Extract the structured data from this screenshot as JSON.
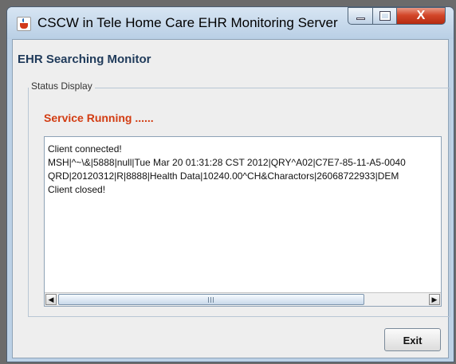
{
  "window": {
    "title": "CSCW in Tele Home Care EHR Monitoring Server",
    "app_icon": "java-coffee-icon",
    "controls": {
      "minimize_icon": "minimize-icon",
      "maximize_icon": "maximize-icon",
      "close_glyph": "X"
    }
  },
  "main": {
    "heading": "EHR Searching Monitor",
    "status_group": {
      "label": "Status Display",
      "status_text": "Service Running ......",
      "status_color": "#d23c12",
      "log_lines": [
        "Client connected!",
        "MSH|^~\\&|5888|null|Tue Mar 20 01:31:28 CST 2012|QRY^A02|C7E7-85-11-A5-0040",
        "QRD|20120312|R|8888|Health Data|10240.00^CH&Charactors|26068722933|DEM",
        "Client closed!"
      ],
      "scrollbar": {
        "left_arrow": "◀",
        "right_arrow": "▶"
      }
    },
    "exit_label": "Exit"
  }
}
